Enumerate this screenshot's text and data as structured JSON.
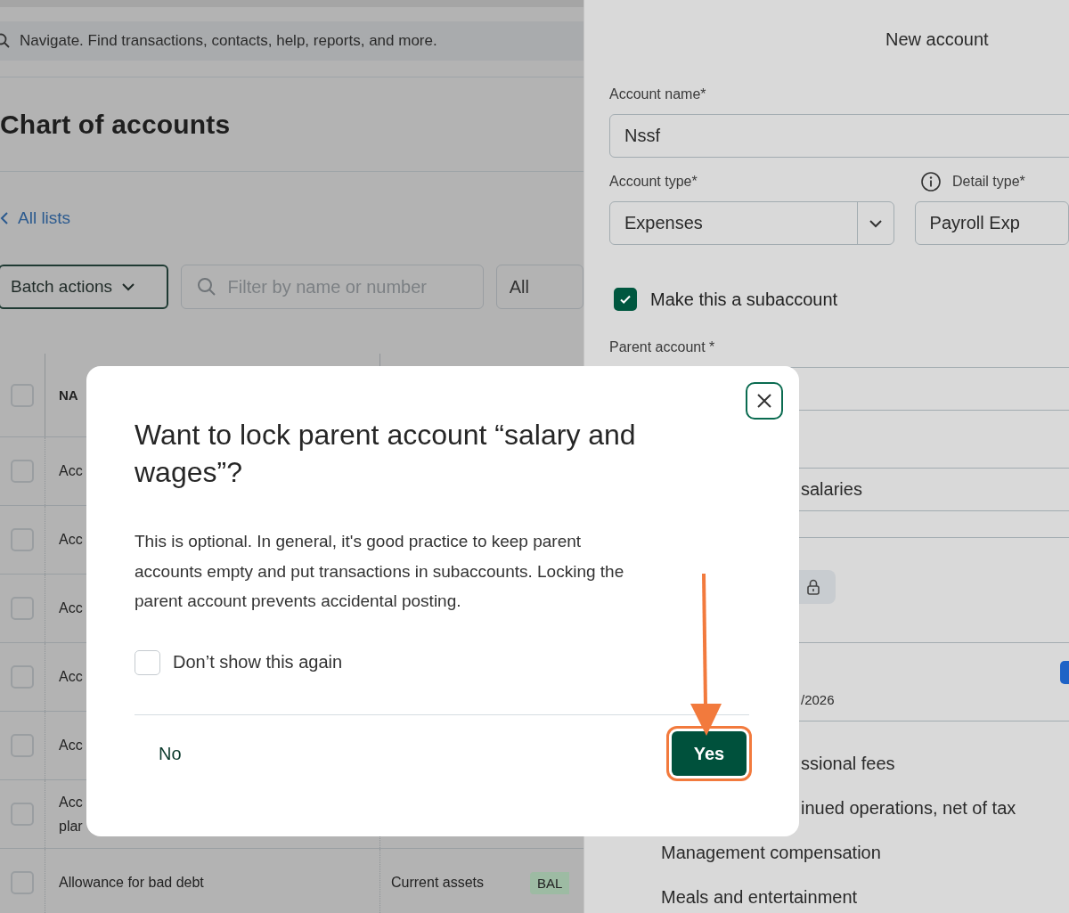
{
  "search": {
    "placeholder": "Navigate. Find transactions, contacts, help, reports, and more."
  },
  "page_title": "Chart of accounts",
  "back_link": "All lists",
  "toolbar": {
    "batch_button": "Batch actions",
    "filter": {
      "placeholder": "Filter by name or number"
    },
    "type_select": "All"
  },
  "table": {
    "header": {
      "checked": false,
      "column_1": "NA"
    },
    "rows": [
      {
        "checked": false,
        "name_lines": [
          "Acc"
        ]
      },
      {
        "checked": false,
        "name_lines": [
          "Acc"
        ]
      },
      {
        "checked": false,
        "name_lines": [
          "Acc"
        ]
      },
      {
        "checked": false,
        "name_lines": [
          "Acc"
        ]
      },
      {
        "checked": false,
        "name_lines": [
          "Acc"
        ]
      },
      {
        "checked": false,
        "name_lines": [
          "Acc",
          "plar"
        ]
      },
      {
        "checked": false,
        "name_lines": [
          "Allowance for bad debt"
        ],
        "type": "Current assets",
        "badge": "BAL"
      }
    ]
  },
  "drawer": {
    "title": "New account",
    "account_name": {
      "label": "Account name*",
      "value": "Nssf"
    },
    "account_type": {
      "label": "Account type*",
      "value": "Expenses"
    },
    "detail_type": {
      "label": "Detail type*",
      "value": "Payroll Exp"
    },
    "subaccount": {
      "label": "Make this a subaccount",
      "checked": true
    },
    "parent_account": {
      "label": "Parent account *"
    },
    "description_value": "salaries",
    "date_text": "/2026",
    "list_items": [
      {
        "text": "ssional fees",
        "cut": true
      },
      {
        "text": "inued operations, net of tax",
        "cut": true
      },
      {
        "text": "Management compensation",
        "cut": false
      },
      {
        "text": "Meals and entertainment",
        "cut": false
      }
    ]
  },
  "modal": {
    "title": "Want to lock parent account “salary and wages”?",
    "body": "This is optional. In general, it's good practice to keep parent accounts empty and put transactions in subaccounts. Locking the parent account prevents accidental posting.",
    "dont_show": {
      "label": "Don’t show this again",
      "checked": false
    },
    "no_button": "No",
    "yes_button": "Yes"
  }
}
